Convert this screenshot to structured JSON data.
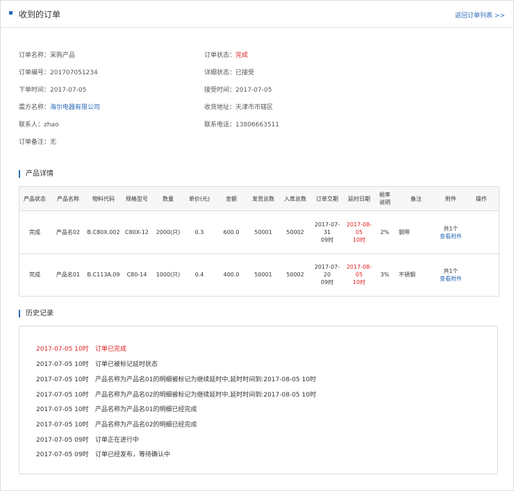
{
  "header": {
    "title": "收到的订单",
    "back_link": "返回订单列表 >>"
  },
  "info": {
    "order_name_label": "订单名称：",
    "order_name": "采购产品",
    "order_status_label": "订单状态：",
    "order_status": "完成",
    "order_no_label": "订单编号：",
    "order_no": "201707051234",
    "detail_status_label": "详细状态：",
    "detail_status": "已接受",
    "order_time_label": "下单时间：",
    "order_time": "2017-07-05",
    "accept_time_label": "接受时间：",
    "accept_time": "2017-07-05",
    "buyer_label": "需方名称：",
    "buyer": "海尔电器有限公司",
    "address_label": "收货地址：",
    "address": "天津市市辖区",
    "contact_label": "联系人：",
    "contact": "zhao",
    "phone_label": "联系电话：",
    "phone": "13806663511",
    "remark_label": "订单备注：",
    "remark": "无"
  },
  "products": {
    "section_title": "产品详情",
    "columns": [
      "产品状态",
      "产品名称",
      "物料代码",
      "规格型号",
      "数量",
      "单价(元)",
      "金额",
      "发货总数",
      "入库总数",
      "订单交期",
      "延时日期",
      "税率\n说明",
      "备注",
      "附件",
      "操作"
    ],
    "rows": [
      {
        "status": "完成",
        "name": "产品名02",
        "code": "B.C80X.002",
        "spec": "C80X-12",
        "qty": "2000(只)",
        "price": "0.3",
        "amount": "600.0",
        "shipped": "50001",
        "stocked": "50002",
        "delivery_date": "2017-07-31",
        "delivery_hour": "09时",
        "delay_date": "2017-08-05",
        "delay_hour": "10时",
        "tax": "2%",
        "remark": "钢带",
        "attach_count": "共1个",
        "attach_link": "查看附件",
        "op": ""
      },
      {
        "status": "完成",
        "name": "产品名01",
        "code": "B.C113A.09",
        "spec": "C80-14",
        "qty": "1000(只)",
        "price": "0.4",
        "amount": "400.0",
        "shipped": "50001",
        "stocked": "50002",
        "delivery_date": "2017-07-20",
        "delivery_hour": "09时",
        "delay_date": "2017-08-05",
        "delay_hour": "10时",
        "tax": "3%",
        "remark": "不锈钢",
        "attach_count": "共1个",
        "attach_link": "查看附件",
        "op": ""
      }
    ]
  },
  "history": {
    "section_title": "历史记录",
    "items": [
      {
        "time": "2017-07-05 10时",
        "text": "订单已完成",
        "highlight": true
      },
      {
        "time": "2017-07-05 10时",
        "text": "订单已被标记延时状态"
      },
      {
        "time": "2017-07-05 10时",
        "text": "产品名称为产品名01的明细被标记为继续延时中,延时时间到:2017-08-05 10时"
      },
      {
        "time": "2017-07-05 10时",
        "text": "产品名称为产品名02的明细被标记为继续延时中,延时时间到:2017-08-05 10时"
      },
      {
        "time": "2017-07-05 10时",
        "text": "产品名称为产品名01的明细已经完成"
      },
      {
        "time": "2017-07-05 10时",
        "text": "产品名称为产品名02的明细已经完成"
      },
      {
        "time": "2017-07-05 09时",
        "text": "订单正在进行中"
      },
      {
        "time": "2017-07-05 09时",
        "text": "订单已经发布，等待确认中"
      }
    ]
  },
  "colors": {
    "accent": "#2a6ab8",
    "red": "#e02020",
    "border": "#dcdcdc",
    "thead_bg": "#f7f7f7"
  }
}
